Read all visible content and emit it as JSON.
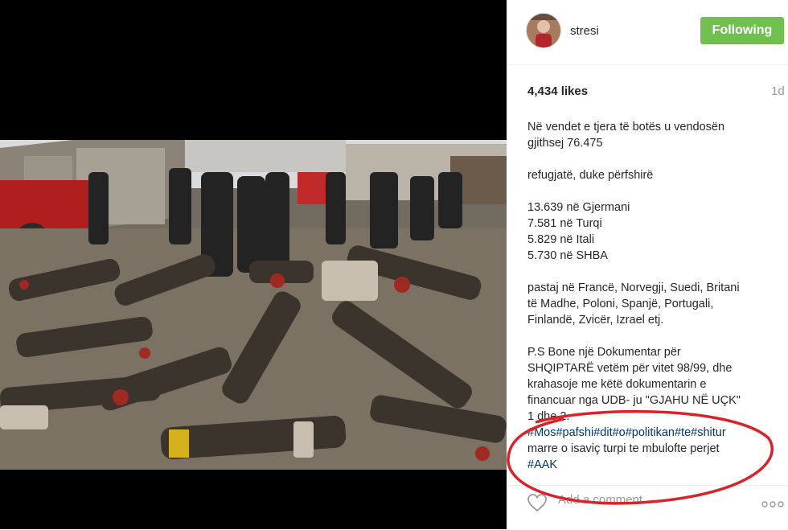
{
  "post": {
    "username": "stresi",
    "follow_label": "Following",
    "likes": "4,434 likes",
    "time": "1d",
    "caption_lines": [
      "Në vendet e tjera të botës u vendosën",
      "gjithsej 76.475",
      "",
      "refugjatë, duke përfshirë",
      "",
      "13.639 në Gjermani",
      "7.581 në Turqi",
      "5.829 në Itali",
      "5.730 në SHBA",
      "",
      "pastaj në Francë, Norvegji, Suedi, Britani",
      "të Madhe, Poloni, Spanjë, Portugali,",
      "Finlandë, Zvicër, Izrael etj.",
      "",
      "P.S Bone një Dokumentar për",
      "SHQIPTARË vetëm për vitet 98/99, dhe",
      "krahasoje me këtë dokumentarin e",
      "financuar nga UDB- ju \"GJAHU NË UÇK\"",
      "1 dhe 2."
    ],
    "hashtags_line": "#Mos#pafshi#dit#o#politikan#te#shitur",
    "comment_line": "marre o isaviç turpi te mbulofte perjet",
    "hashtag_aak": "#AAK",
    "comment_placeholder": "Add a comment...",
    "more_label": "...",
    "colors": {
      "follow": "#70c050",
      "hashtag": "#003569",
      "annotation": "#d8232a"
    }
  }
}
